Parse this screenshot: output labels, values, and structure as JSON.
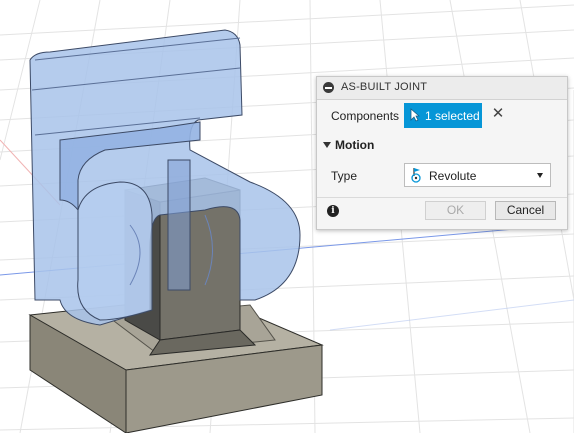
{
  "dialog": {
    "title": "AS-BUILT JOINT",
    "components_label": "Components",
    "selection_text": "1 selected",
    "motion_section": "Motion",
    "type_label": "Type",
    "type_value": "Revolute",
    "ok_label": "OK",
    "cancel_label": "Cancel"
  },
  "icons": {
    "collapse": "collapse-icon",
    "cursor": "select-cursor-icon",
    "clear": "close-icon",
    "revolute": "revolute-joint-icon",
    "info": "info-icon"
  },
  "colors": {
    "accent": "#0696d7",
    "part_blue": "#a8c3ea",
    "base_gray": "#8a8678"
  }
}
